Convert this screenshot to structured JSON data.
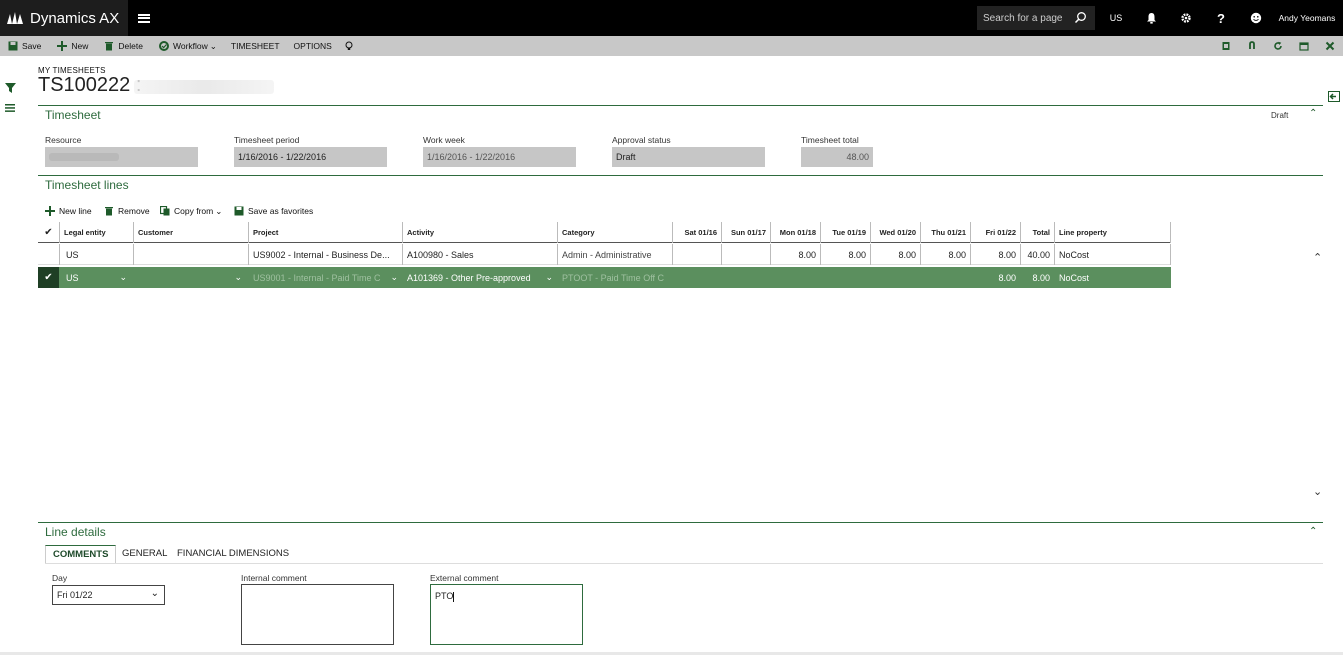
{
  "app": {
    "name": "Dynamics AX"
  },
  "topbar": {
    "search_placeholder": "Search for a page",
    "company": "US",
    "user": "Andy Yeomans"
  },
  "actions": {
    "save": "Save",
    "new": "New",
    "delete": "Delete",
    "workflow": "Workflow",
    "timesheet": "TIMESHEET",
    "options": "OPTIONS"
  },
  "page": {
    "label": "MY TIMESHEETS",
    "title": "TS100222 :"
  },
  "timesheet": {
    "section_title": "Timesheet",
    "status_right": "Draft",
    "fields": {
      "resource_label": "Resource",
      "period_label": "Timesheet period",
      "period_value": "1/16/2016 - 1/22/2016",
      "week_label": "Work week",
      "week_value": "1/16/2016 - 1/22/2016",
      "approval_label": "Approval status",
      "approval_value": "Draft",
      "total_label": "Timesheet total",
      "total_value": "48.00"
    }
  },
  "lines": {
    "section_title": "Timesheet lines",
    "toolbar": {
      "new_line": "New line",
      "remove": "Remove",
      "copy_from": "Copy from",
      "save_fav": "Save as favorites"
    },
    "columns": {
      "legal_entity": "Legal entity",
      "customer": "Customer",
      "project": "Project",
      "activity": "Activity",
      "category": "Category",
      "sat": "Sat 01/16",
      "sun": "Sun 01/17",
      "mon": "Mon 01/18",
      "tue": "Tue 01/19",
      "wed": "Wed 01/20",
      "thu": "Thu 01/21",
      "fri": "Fri 01/22",
      "total": "Total",
      "line_property": "Line property"
    },
    "rows": [
      {
        "legal_entity": "US",
        "customer": "",
        "project": "US9002 - Internal - Business De...",
        "activity": "A100980 - Sales",
        "category": "Admin - Administrative",
        "sat": "",
        "sun": "",
        "mon": "8.00",
        "tue": "8.00",
        "wed": "8.00",
        "thu": "8.00",
        "fri": "8.00",
        "total": "40.00",
        "line_property": "NoCost"
      },
      {
        "legal_entity": "US",
        "customer": "",
        "project": "US9001 - Internal - Paid Time C",
        "activity": "A101369 - Other Pre-approved",
        "category": "PTOOT - Paid Time Off C",
        "sat": "",
        "sun": "",
        "mon": "",
        "tue": "",
        "wed": "",
        "thu": "",
        "fri": "8.00",
        "total": "8.00",
        "line_property": "NoCost"
      }
    ]
  },
  "details": {
    "section_title": "Line details",
    "tabs": [
      "COMMENTS",
      "GENERAL",
      "FINANCIAL DIMENSIONS"
    ],
    "day_label": "Day",
    "day_value": "Fri 01/22",
    "internal_label": "Internal comment",
    "internal_value": "",
    "external_label": "External comment",
    "external_value": "PTO"
  },
  "colors": {
    "accent": "#2e6b3e",
    "selected_row": "#5b8f5e",
    "action_bar": "#c8c8c8",
    "field_bg": "#c6c6c6"
  }
}
